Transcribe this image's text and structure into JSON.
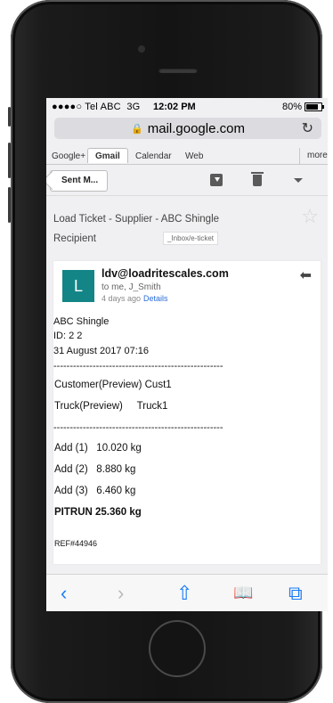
{
  "status_bar": {
    "carrier": "●●●●○ Tel ABC",
    "network": "3G",
    "time": "12:02 PM",
    "battery": "80%",
    "battery_level": 0.8
  },
  "browser": {
    "url": "mail.google.com"
  },
  "top_tabs": {
    "googleplus": "Google+",
    "gmail": "Gmail",
    "calendar": "Calendar",
    "web": "Web",
    "more": "more"
  },
  "toolbar": {
    "back_label": "Sent M..."
  },
  "email": {
    "subject": "Load Ticket - Supplier - ABC Shingle",
    "recipient_label": "Recipient",
    "inbox_label": "_Inbox/e-ticket",
    "avatar_letter": "L",
    "sender": "ldv@loadritescales.com",
    "to": "to me, J_Smith",
    "date": "4 days ago",
    "details": "Details",
    "body": {
      "company": "ABC Shingle",
      "id": "ID: 2 2",
      "datetime": "31 August 2017 07:16",
      "divider1": "----------------------------------------------------",
      "customer_label": "Customer(Preview)",
      "customer_value": "Cust1",
      "truck_label": "Truck(Preview)",
      "truck_value": "Truck1",
      "divider2": "----------------------------------------------------",
      "add1": "Add (1)   10.020 kg",
      "add2": "Add (2)   8.880 kg",
      "add3": "Add (3)   6.460 kg",
      "total": "PITRUN 25.360 kg",
      "ref": "REF#44946"
    }
  },
  "bottom_bar": {
    "back": "‹",
    "forward": "›",
    "share": "⇧",
    "bookmarks": "📖",
    "tabs": "⧉"
  }
}
